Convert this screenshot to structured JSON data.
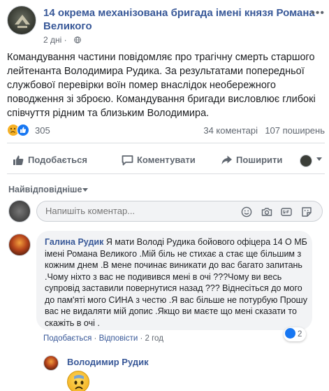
{
  "post": {
    "page_name": "14 окрема механізована бригада імені князя Романа Великого",
    "time": "2 дні",
    "time_separator": "·",
    "text": "Командування частини повідомляє про трагічну смерть старшого лейтенанта Володимира Рудика. За результатами попередньої службової перевірки воїн помер внаслідок необережного поводження зі зброєю. Командування бригади висловлює глибокі співчуття рідним та близьким Володимира."
  },
  "reactions": {
    "count": "305",
    "comments": "34 коментарі",
    "shares": "107 поширень"
  },
  "actions": {
    "like": "Подобається",
    "comment": "Коментувати",
    "share": "Поширити"
  },
  "sort_label": "Найвідповідніше",
  "composer": {
    "placeholder": "Напишіть коментар..."
  },
  "comment": {
    "author": "Галина Рудик",
    "text": "Я мати Володі Рудика бойового офіцера 14 О МБ імені Романа Великого .Мій біль не стихає а стає ще більшим з кожним днем .В мене починає виникати до вас багато запитань .Чому ніхто з вас не подивився мені в очі ???Чому ви весь супровід заставили повернутися назад ??? Віднесіться до мого до пам'яті мого СИНА з честю .Я вас більше не потурбую Прошу вас не видаляти мій допис .Якщо ви маєте що мені сказати то скажіть в очі .",
    "reaction_count": "2",
    "like_label": "Подобається",
    "reply_label": "Відповісти",
    "time": "2 год",
    "separator": "·"
  },
  "reply": {
    "author": "Володимир Рудик"
  },
  "colors": {
    "link": "#385898",
    "secondary_text": "#606770",
    "like_blue": "#1877f2",
    "bubble": "#f2f3f5"
  }
}
